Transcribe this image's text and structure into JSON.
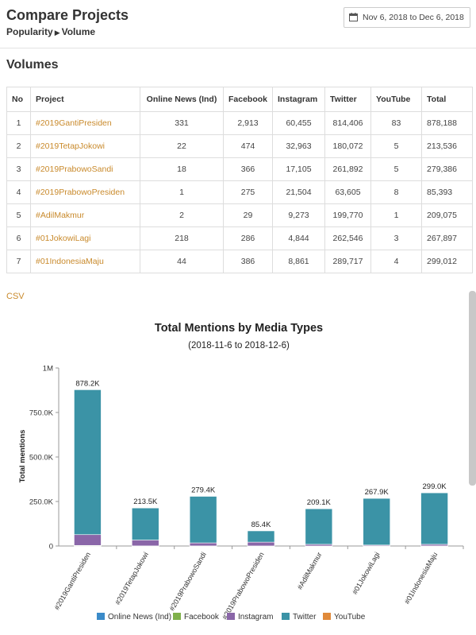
{
  "header": {
    "title": "Compare Projects",
    "breadcrumb": {
      "first": "Popularity",
      "separator": "▶",
      "second": "Volume"
    },
    "date_range": "Nov 6, 2018 to Dec 6, 2018"
  },
  "volumes": {
    "title": "Volumes",
    "columns": [
      "No",
      "Project",
      "Online News (Ind)",
      "Facebook",
      "Instagram",
      "Twitter",
      "YouTube",
      "Total"
    ],
    "rows": [
      [
        "1",
        "#2019GantiPresiden",
        "331",
        "2,913",
        "60,455",
        "814,406",
        "83",
        "878,188"
      ],
      [
        "2",
        "#2019TetapJokowi",
        "22",
        "474",
        "32,963",
        "180,072",
        "5",
        "213,536"
      ],
      [
        "3",
        "#2019PrabowoSandi",
        "18",
        "366",
        "17,105",
        "261,892",
        "5",
        "279,386"
      ],
      [
        "4",
        "#2019PrabowoPresiden",
        "1",
        "275",
        "21,504",
        "63,605",
        "8",
        "85,393"
      ],
      [
        "5",
        "#AdilMakmur",
        "2",
        "29",
        "9,273",
        "199,770",
        "1",
        "209,075"
      ],
      [
        "6",
        "#01JokowiLagi",
        "218",
        "286",
        "4,844",
        "262,546",
        "3",
        "267,897"
      ],
      [
        "7",
        "#01IndonesiaMaju",
        "44",
        "386",
        "8,861",
        "289,717",
        "4",
        "299,012"
      ]
    ],
    "csv_label": "CSV"
  },
  "chart_data": {
    "type": "bar",
    "stacked": true,
    "title": "Total Mentions by Media Types",
    "subtitle": "(2018-11-6 to 2018-12-6)",
    "ylabel": "Total mentions",
    "xlabel": "",
    "ylim": [
      0,
      1000000
    ],
    "yticks": [
      0,
      250000,
      500000,
      750000,
      1000000
    ],
    "ytick_labels": [
      "0",
      "250.0K",
      "500.0K",
      "750.0K",
      "1M"
    ],
    "legend_position": "bottom",
    "categories": [
      "#2019GantiPresiden",
      "#2019TetapJokowi",
      "#2019PrabowoSandi",
      "#2019PrabowoPresiden",
      "#AdilMakmur",
      "#01JokowiLagi",
      "#01IndonesiaMaju"
    ],
    "totals_labels": [
      "878.2K",
      "213.5K",
      "279.4K",
      "85.4K",
      "209.1K",
      "267.9K",
      "299.0K"
    ],
    "series": [
      {
        "name": "Online News (Ind)",
        "color": "#3b8bc9",
        "values": [
          331,
          22,
          18,
          1,
          2,
          218,
          44
        ]
      },
      {
        "name": "Facebook",
        "color": "#7fb04a",
        "values": [
          2913,
          474,
          366,
          275,
          29,
          286,
          386
        ]
      },
      {
        "name": "Instagram",
        "color": "#8a66a8",
        "values": [
          60455,
          32963,
          17105,
          21504,
          9273,
          4844,
          8861
        ]
      },
      {
        "name": "Twitter",
        "color": "#3b93a6",
        "values": [
          814406,
          180072,
          261892,
          63605,
          199770,
          262546,
          289717
        ]
      },
      {
        "name": "YouTube",
        "color": "#e08a3a",
        "values": [
          83,
          5,
          5,
          8,
          1,
          3,
          4
        ]
      }
    ],
    "grid": false
  }
}
